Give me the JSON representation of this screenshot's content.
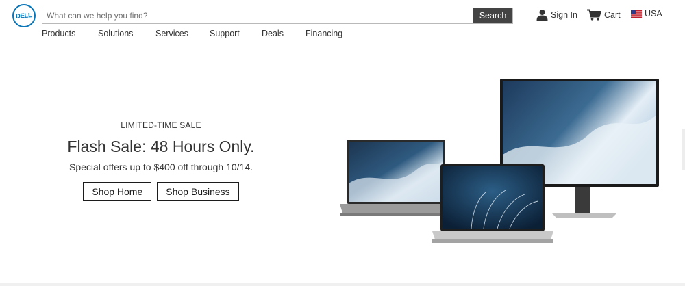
{
  "header": {
    "logo_text": "DELL",
    "search_placeholder": "What can we help you find?",
    "search_button": "Search",
    "sign_in": "Sign In",
    "cart": "Cart",
    "country": "USA"
  },
  "nav": {
    "items": [
      "Products",
      "Solutions",
      "Services",
      "Support",
      "Deals",
      "Financing"
    ]
  },
  "hero": {
    "eyebrow": "LIMITED-TIME SALE",
    "headline": "Flash Sale: 48 Hours Only.",
    "subhead": "Special offers up to $400 off through 10/14.",
    "button_home": "Shop Home",
    "button_business": "Shop Business"
  },
  "colors": {
    "brand": "#0a76b7",
    "search_button_bg": "#444444",
    "text": "#1c1c1c"
  },
  "icons": {
    "user": "person-icon",
    "cart": "cart-icon",
    "flag": "us-flag-icon"
  }
}
